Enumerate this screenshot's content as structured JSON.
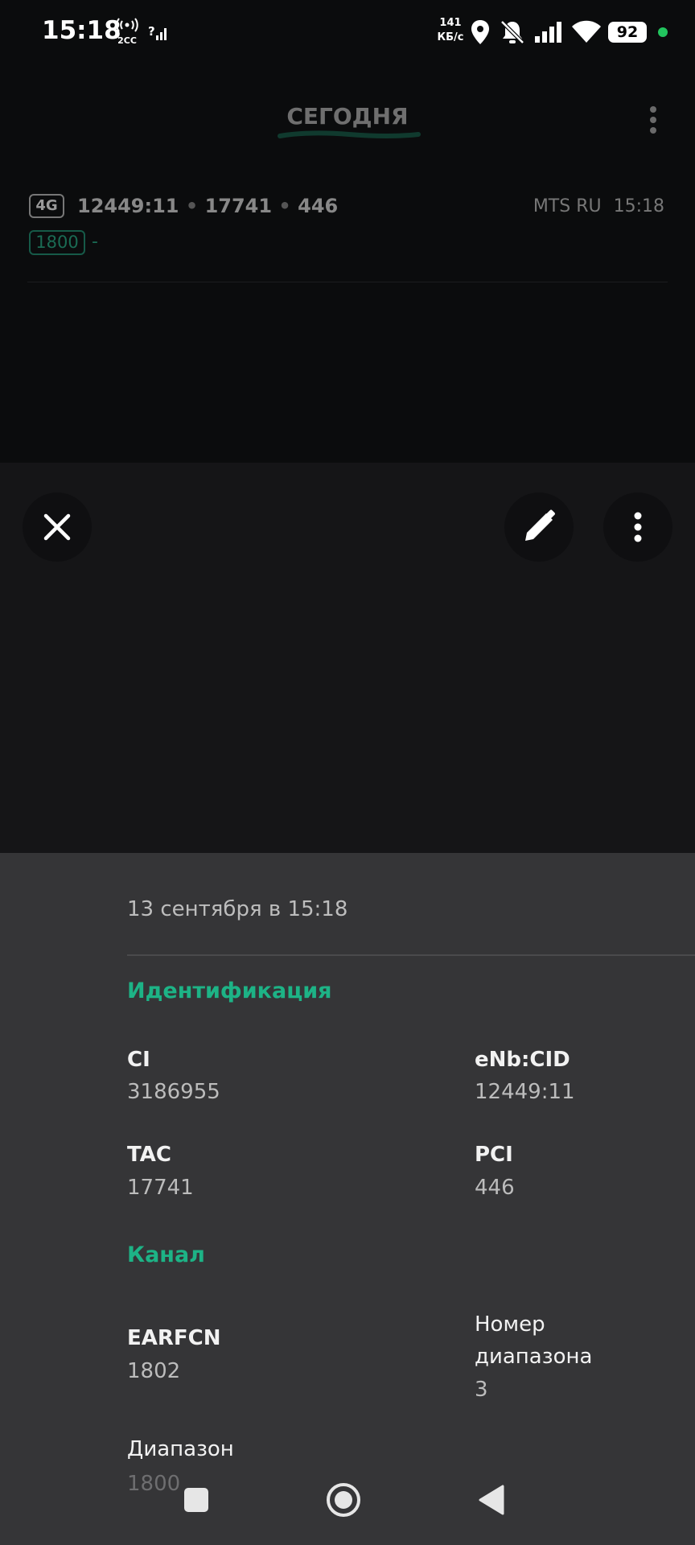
{
  "status_bar": {
    "time": "15:18",
    "speed_value": "141",
    "speed_unit": "КБ/с",
    "battery": "92",
    "volte_label": "2СС",
    "icons": [
      "hotspot-icon",
      "signal-question-icon",
      "location-icon",
      "mute-icon",
      "signal-icon",
      "wifi-icon",
      "battery-icon"
    ]
  },
  "header": {
    "title": "СЕГОДНЯ"
  },
  "record": {
    "tech": "4G",
    "enb_cid": "12449:11",
    "tac": "17741",
    "pci": "446",
    "operator": "MTS RU",
    "time": "15:18",
    "band": "1800",
    "band_extra": "-"
  },
  "sheet": {
    "date": "13 сентября в 15:18",
    "sections": {
      "identification": "Идентификация",
      "channel": "Канал"
    },
    "fields": {
      "ci_label": "CI",
      "ci_value": "3186955",
      "enb_label": "eNb:CID",
      "enb_value": "12449:11",
      "tac_label": "TAC",
      "tac_value": "17741",
      "pci_label": "PCI",
      "pci_value": "446",
      "earfcn_label": "EARFCN",
      "earfcn_value": "1802",
      "band_num_label_1": "Номер",
      "band_num_label_2": "диапазона",
      "band_num_value": "3",
      "band_label": "Диапазон",
      "band_value": "1800"
    }
  },
  "colors": {
    "accent": "#1db386",
    "sheet_bg": "#353537",
    "background": "#0b0c0d"
  }
}
